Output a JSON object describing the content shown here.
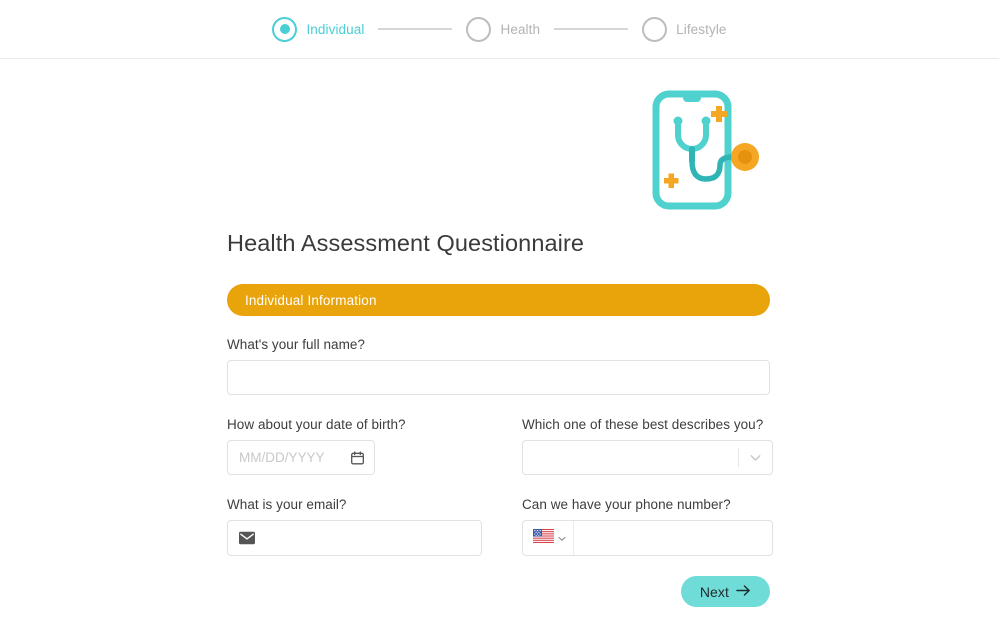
{
  "stepper": {
    "steps": [
      {
        "label": "Individual",
        "state": "active",
        "icon": "filled-circle-icon"
      },
      {
        "label": "Health",
        "state": "inactive",
        "icon": "empty-circle-icon"
      },
      {
        "label": "Lifestyle",
        "state": "inactive",
        "icon": "empty-circle-icon"
      }
    ]
  },
  "illustration": {
    "name": "phone-stethoscope-illustration",
    "teal": "#4fd1cd",
    "orange": "#f5a623"
  },
  "page": {
    "title": "Health Assessment Questionnaire"
  },
  "section": {
    "label": "Individual Information",
    "color": "#e9a30b"
  },
  "form": {
    "full_name": {
      "label": "What's your full name?",
      "value": "",
      "placeholder": ""
    },
    "date_of_birth": {
      "label": "How about your date of birth?",
      "value": "",
      "placeholder": "MM/DD/YYYY",
      "icon": "calendar-icon"
    },
    "describes_you": {
      "label": "Which one of these best describes you?",
      "value": "",
      "icon": "chevron-down-icon"
    },
    "email": {
      "label": "What is your email?",
      "value": "",
      "placeholder": "",
      "icon": "envelope-icon"
    },
    "phone": {
      "label": "Can we have your phone number?",
      "value": "",
      "placeholder": "",
      "country_flag": "us-flag-icon",
      "icon": "chevron-down-icon"
    }
  },
  "actions": {
    "next_label": "Next",
    "next_icon": "arrow-right-icon",
    "next_color": "#6fdcd8"
  }
}
